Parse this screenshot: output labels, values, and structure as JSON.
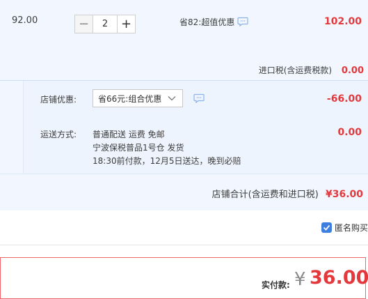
{
  "item": {
    "price": "92.00",
    "quantity": "2",
    "minus_label": "−",
    "plus_label": "+",
    "promo_text": "省82:超值优惠",
    "subtotal": "102.00",
    "import_tax_label": "进口税(含运费税款)",
    "import_tax_value": "0.00"
  },
  "store": {
    "discount_label": "店铺优惠:",
    "discount_selected": "省66元:组合优惠",
    "discount_value": "-66.00",
    "shipping_label": "运送方式:",
    "shipping_lines": [
      "普通配送 运费 免邮",
      "宁波保税普品1号仓  发货",
      "18:30前付款，12月5日送达，晚到必赔"
    ],
    "shipping_value": "0.00",
    "total_label": "店铺合计(含运费和进口税)",
    "total_value": "¥36.00"
  },
  "anonymous": {
    "label": "匿名购买",
    "checked": true
  },
  "payment": {
    "label": "实付款:",
    "currency": "¥",
    "amount": "36.00"
  },
  "colors": {
    "accent_red": "#e4393c",
    "panel_bg": "#f2f7ff",
    "checkbox_blue": "#3d7ee1"
  }
}
